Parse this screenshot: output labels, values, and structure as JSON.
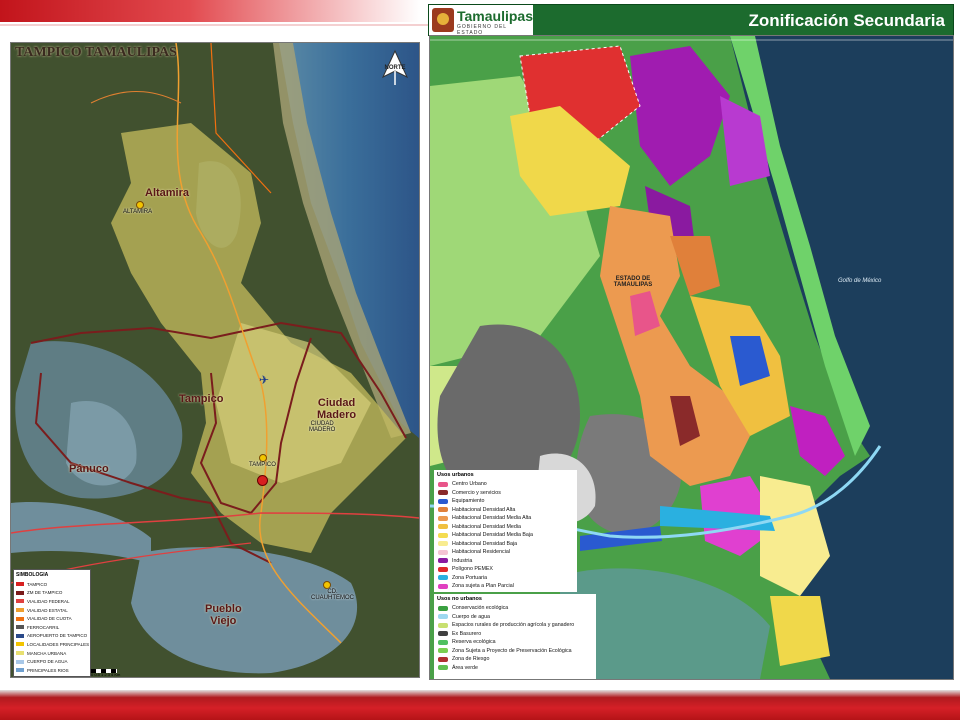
{
  "header": {
    "logo_name": "Tamaulipas",
    "logo_subtitle": "GOBIERNO DEL ESTADO",
    "title": "Zonificación Secundaria"
  },
  "left_map": {
    "title": "TAMPICO TAMAULIPAS",
    "north_label": "NORTE",
    "places": {
      "altamira": "Altamira",
      "altamira_loc": "ALTAMIRA",
      "tampico": "Tampico",
      "tampico_loc": "TAMPICO",
      "ciudad_madero": "Ciudad\nMadero",
      "ciudad_madero_loc": "CIUDAD\nMADERO",
      "panuco": "Pánuco",
      "pueblo_viejo": "Pueblo\nViejo",
      "cuauhtemoc_loc": "CD.\nCUAUHTEMOC"
    },
    "legend": {
      "title": "SIMBOLOGIA",
      "items": [
        {
          "label": "TAMPICO",
          "color": "#d72020"
        },
        {
          "label": "ZM DE TAMPICO",
          "color": "#7a1a1a"
        },
        {
          "label": "VIALIDAD FEDERAL",
          "color": "#e04040"
        },
        {
          "label": "VIALIDAD ESTATAL",
          "color": "#f0a030"
        },
        {
          "label": "VIALIDAD DE CUOTA",
          "color": "#f07010"
        },
        {
          "label": "FERROCARRIL",
          "color": "#555555"
        },
        {
          "label": "AEROPUERTO DE TAMPICO",
          "color": "#2a4a8a"
        },
        {
          "label": "LOCALIDADES PRINCIPALES",
          "color": "#f2c400"
        },
        {
          "label": "MANCHA URBANA",
          "color": "#e8e070"
        },
        {
          "label": "CUERPO DE AGUA",
          "color": "#a8c8e8"
        },
        {
          "label": "PRINCIPALES RIOS",
          "color": "#6fa0d0"
        }
      ],
      "scale_label": "0  0.5  1    2    3    4 Km"
    }
  },
  "right_map": {
    "estado_label": "ESTADO DE\nTAMAULIPAS",
    "gulf_label": "Golfo de México",
    "legend_urban": {
      "title": "Usos urbanos",
      "items": [
        {
          "label": "Centro Urbano",
          "color": "#e8558a"
        },
        {
          "label": "Comercio y servicios",
          "color": "#8a2a2a"
        },
        {
          "label": "Equipamiento",
          "color": "#2a5ad0"
        },
        {
          "label": "Habitacional Densidad Alta",
          "color": "#e0803a"
        },
        {
          "label": "Habitacional Densidad Media Alta",
          "color": "#ec9a50"
        },
        {
          "label": "Habitacional Densidad Media",
          "color": "#f0c040"
        },
        {
          "label": "Habitacional Densidad Media Baja",
          "color": "#f4dc50"
        },
        {
          "label": "Habitacional Densidad Baja",
          "color": "#f8ec90"
        },
        {
          "label": "Habitacional Residencial",
          "color": "#f4c4d4"
        },
        {
          "label": "Industria",
          "color": "#8a1aa0"
        },
        {
          "label": "Polígono PEMEX",
          "color": "#e02a2a"
        },
        {
          "label": "Zona Portuaria",
          "color": "#2ab0e0"
        },
        {
          "label": "Zona sujeta a Plan Parcial",
          "color": "#e040c0"
        }
      ]
    },
    "legend_nonurban": {
      "title": "Usos no urbanos",
      "items": [
        {
          "label": "Conservación ecológica",
          "color": "#3aa040"
        },
        {
          "label": "Cuerpo de agua",
          "color": "#9ed8f0"
        },
        {
          "label": "Espacios rurales de producción agrícola y ganadero",
          "color": "#c8e070"
        },
        {
          "label": "Ex Basurero",
          "color": "#404040"
        },
        {
          "label": "Reserva ecológica",
          "color": "#50c060"
        },
        {
          "label": "Zona Sujeta a Proyecto de Preservación Ecológica",
          "color": "#7ad050"
        },
        {
          "label": "Zona de Riesgo",
          "color": "#b03030"
        },
        {
          "label": "Área verde",
          "color": "#60c050"
        }
      ]
    }
  }
}
